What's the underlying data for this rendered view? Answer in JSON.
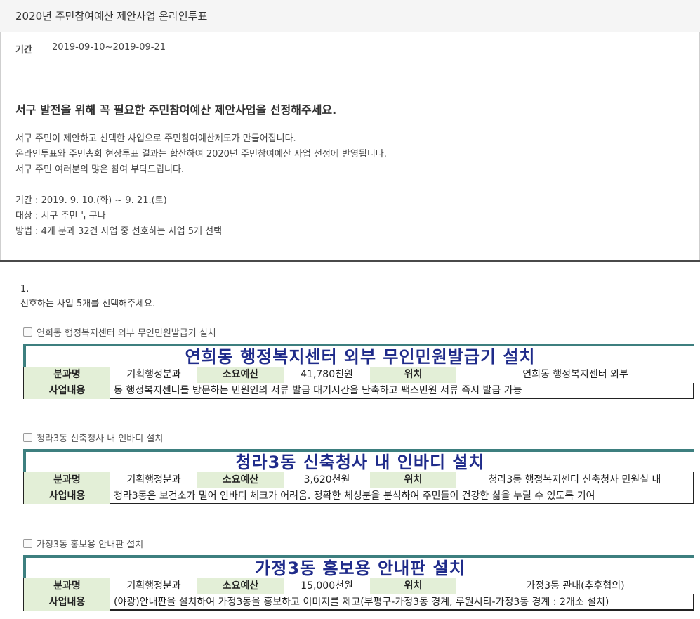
{
  "title": "2020년 주민참여예산 제안사업 온라인투표",
  "period": {
    "label": "기간",
    "value": "2019-09-10~2019-09-21"
  },
  "intro": {
    "heading": "서구 발전을 위해 꼭 필요한 주민참여예산 제안사업을 선정해주세요.",
    "lines": [
      "서구 주민이 제안하고 선택한 사업으로 주민참여예산제도가 만들어집니다.",
      "온라인투표와 주민총회 현장투표 결과는 합산하여 2020년 주민참여예산 사업 선정에 반영됩니다.",
      "서구 주민 여러분의 많은 참여 부탁드립니다."
    ],
    "details": [
      "기간 : 2019. 9. 10.(화) ~ 9. 21.(토)",
      "대상 : 서구 주민 누구나",
      "방법 : 4개 분과 32건 사업 중 선호하는 사업 5개 선택"
    ]
  },
  "question": {
    "number": "1.",
    "text": "선호하는 사업 5개를 선택해주세요."
  },
  "labels": {
    "dept": "분과명",
    "budget": "소요예산",
    "location": "위치",
    "content": "사업내용"
  },
  "items": [
    {
      "checkbox_label": "연희동 행정복지센터 외부 무인민원발급기 설치",
      "title": "연희동 행정복지센터 외부 무인민원발급기 설치",
      "dept": "기획행정분과",
      "budget": "41,780천원",
      "location": "연희동 행정복지센터 외부",
      "content": "동 행정복지센터를 방문하는 민원인의 서류 발급 대기시간을 단축하고 팩스민원 서류 즉시 발급 가능",
      "checked": false
    },
    {
      "checkbox_label": "청라3동 신축청사 내 인바디 설치",
      "title": "청라3동 신축청사 내 인바디 설치",
      "dept": "기획행정분과",
      "budget": "3,620천원",
      "location": "청라3동 행정복지센터 신축청사 민원실 내",
      "content": "청라3동은 보건소가 멀어 인바디 체크가 어려움. 정확한 체성분을 분석하여 주민들이 건강한 삶을 누릴 수 있도록 기여",
      "checked": false
    },
    {
      "checkbox_label": "가정3동 홍보용 안내판 설치",
      "title": "가정3동 홍보용 안내판 설치",
      "dept": "기획행정분과",
      "budget": "15,000천원",
      "location": "가정3동 관내(추후협의)",
      "content": "(야광)안내판을 설치하여 가정3동을 홍보하고 이미지를 제고(부평구-가정3동 경계, 루원시티-가정3동 경계 : 2개소 설치)",
      "checked": false
    }
  ]
}
